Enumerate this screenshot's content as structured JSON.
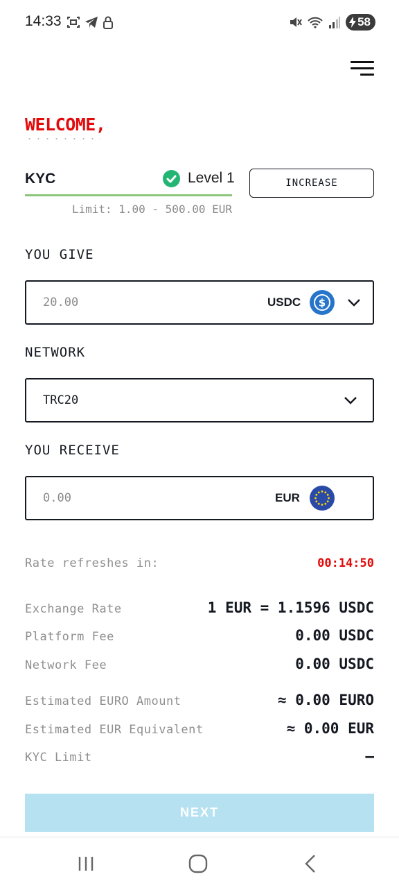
{
  "status_bar": {
    "time": "14:33",
    "battery": "58"
  },
  "header": {
    "welcome": "WELCOME,"
  },
  "kyc": {
    "label": "KYC",
    "level": "Level 1",
    "limit": "Limit: 1.00 - 500.00 EUR",
    "increase_label": "INCREASE"
  },
  "give": {
    "label": "YOU GIVE",
    "placeholder": "20.00",
    "currency": "USDC",
    "coin_icon": "usdc-coin-icon"
  },
  "network": {
    "label": "NETWORK",
    "value": "TRC20"
  },
  "receive": {
    "label": "YOU RECEIVE",
    "placeholder": "0.00",
    "currency": "EUR",
    "coin_icon": "eur-coin-icon"
  },
  "rate_refresh": {
    "label": "Rate refreshes in:",
    "timer": "00:14:50"
  },
  "details": [
    {
      "label": "Exchange Rate",
      "value": "1 EUR = 1.1596 USDC"
    },
    {
      "label": "Platform Fee",
      "value": "0.00 USDC"
    },
    {
      "label": "Network Fee",
      "value": "0.00 USDC"
    },
    {
      "label": "Estimated EURO Amount",
      "value": "≈ 0.00 EURO"
    },
    {
      "label": "Estimated EUR Equivalent",
      "value": "≈ 0.00 EUR"
    },
    {
      "label": "KYC Limit",
      "value": "–"
    }
  ],
  "actions": {
    "next_label": "NEXT"
  },
  "colors": {
    "accent_red": "#e10b0b",
    "kyc_green": "#22b573",
    "usdc_blue": "#2775ca",
    "eur_blue": "#2a4aa8",
    "next_bg": "#b6e1f1"
  }
}
